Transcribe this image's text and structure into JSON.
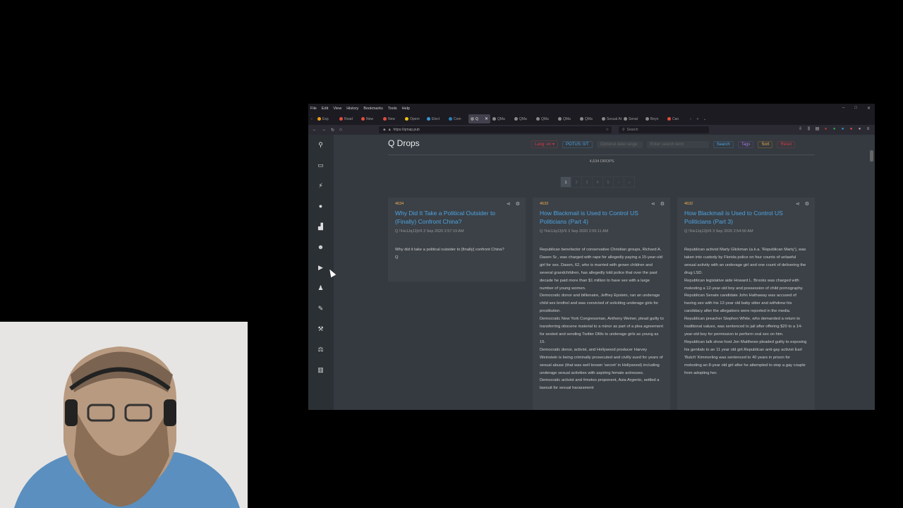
{
  "browser": {
    "menu": [
      "File",
      "Edit",
      "View",
      "History",
      "Bookmarks",
      "Tools",
      "Help"
    ],
    "tabs": [
      {
        "label": "Exp",
        "color": "#f39c12"
      },
      {
        "label": "Read",
        "color": "#e74c3c"
      },
      {
        "label": "New",
        "color": "#e74c3c"
      },
      {
        "label": "New",
        "color": "#e74c3c"
      },
      {
        "label": "Opem",
        "color": "#f1c40f"
      },
      {
        "label": "Elect",
        "color": "#3498db"
      },
      {
        "label": "Com",
        "color": "#2980b9"
      },
      {
        "label": "Q",
        "color": "#888888",
        "active": true
      },
      {
        "label": "QMa",
        "color": "#888888"
      },
      {
        "label": "QMa",
        "color": "#888888"
      },
      {
        "label": "QMa",
        "color": "#888888"
      },
      {
        "label": "QMa",
        "color": "#888888"
      },
      {
        "label": "QMa",
        "color": "#888888"
      },
      {
        "label": "Sexual Ab",
        "color": "#888888"
      },
      {
        "label": "Senat",
        "color": "#888888"
      },
      {
        "label": "Beyo",
        "color": "#888888"
      },
      {
        "label": "Can",
        "color": "#e74c3c"
      }
    ],
    "url": "https://qmap.pub",
    "search_placeholder": "Search"
  },
  "page": {
    "title": "Q Drops",
    "filters": {
      "lang": "Lang: en ▾",
      "potus": "POTUS: 0/T",
      "date_placeholder": "Optional date range",
      "term_placeholder": "Enter search term",
      "search": "Search",
      "tags": "Tags",
      "sort": "Sort",
      "reset": "Reset"
    },
    "drops_count": "4,634 DROPS",
    "pages": [
      "1",
      "2",
      "3",
      "4",
      "5",
      "›",
      "»"
    ]
  },
  "cards": [
    {
      "number": "4634",
      "title": "Why Did It Take a Political Outsider to (Finally) Confront China?",
      "meta": "Q  !!Hs1Jq13jV6  3 Sep 2020  2:57:19 AM",
      "body": "Why did it take a political outsider to [finally] confront China?\nQ"
    },
    {
      "number": "4633",
      "title": "How Blackmail is Used to Control US Politicians (Part 4)",
      "meta": "Q  !!Hs1Jq13jV6  3 Sep 2020  2:55:11 AM",
      "body": "Republican benefactor of conservative Christian groups, Richard A. Dasen Sr., was charged with rape for allegedly paying a 15-year-old girl for sex. Dasen, 62, who is married with grown children and several grandchildren, has allegedly told police that over the past decade he paid more than $1 million to have sex with a large number of young women.\nDemocratic donor and billionaire, Jeffrey Epstein, ran an underage child sex brothel and was convicted of soliciting underage girls for prostitution.\nDemocratic New York Congressman, Anthony Weiner, plead guilty to transferring obscene material to a minor as part of a plea agreement for sexted and sending Twitter DMs to underage girls as young as 15.\nDemocratic donor, activist, and Hollywood producer Harvey Weinstein is being criminally prosecuted and civilly sued for years of sexual abuse (that was well known 'secret' in Hollywood) including underage sexual activities with aspiring female actresses.\nDemocratic activist and #metoo proponent, Asia Argento, settled a lawsuit for sexual harassment"
    },
    {
      "number": "4632",
      "title": "How Blackmail is Used to Control US Politicians (Part 3)",
      "meta": "Q  !!Hs1Jq13jV6  3 Sep 2020  2:54:50 AM",
      "body": "Republican activist Marty Glickman (a.k.a. 'Republican Marty'), was taken into custody by Florida police on four counts of unlawful sexual activity with an underage girl and one count of delivering the drug LSD.\nRepublican legislative aide Howard L. Brooks was charged with molesting a 12-year-old boy and possession of child pornography.\nRepublican Senate candidate John Hathaway was accused of having sex with his 12-year old baby sitter and withdrew his candidacy after the allegations were reported in the media.\nRepublican preacher Stephen White, who demanded a return to traditional values, was sentenced to jail after offering $20 to a 14-year-old boy for permission to perform oral sex on him.\nRepublican talk show host Jon Matthews pleaded guilty to exposing his genitals to an 11 year old girl.Republican anti-gay activist Earl 'Butch' Kimmerling was sentenced to 40 years in prison for molesting an 8-year old girl after he attempted to stop a gay couple from adopting her."
    }
  ],
  "colors": {
    "page_bg": "#343a40",
    "sidebar_bg": "#2b3035",
    "card_bg": "#3b4147",
    "link": "#4fa3e0",
    "drop_number": "#f0ad4e"
  },
  "sidebar_icons": [
    "search-icon",
    "news-icon",
    "running-person-icon",
    "globe-icon",
    "podium-icon",
    "skull-icon",
    "video-icon",
    "user-icon",
    "pencil-icon",
    "gavel-icon",
    "scales-icon",
    "chart-icon"
  ]
}
